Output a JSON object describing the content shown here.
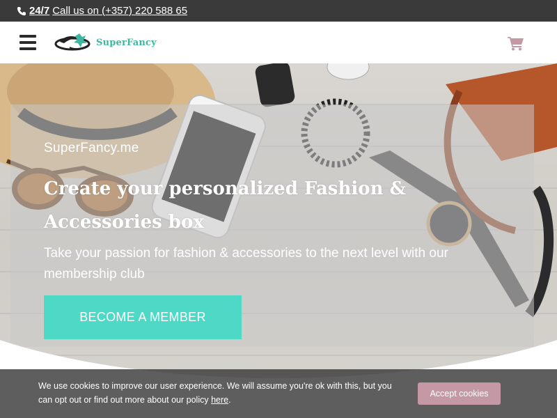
{
  "topbar": {
    "hours": "24/7",
    "call": "Call us on (+357) 220 588 65"
  },
  "header": {
    "brand": "SuperFancy"
  },
  "hero": {
    "site": "SuperFancy.me",
    "headline": "Create your personalized Fashion & Accessories box",
    "subtitle": "Take your passion for fashion & accessories to the next level with our membership club",
    "cta": "BECOME A MEMBER"
  },
  "cookie": {
    "text_before": "We use cookies to improve our user experience. We will assume you're ok with this, but you can opt out or find out more about our policy ",
    "link": "here",
    "text_after": ".",
    "accept": "Accept cookies"
  },
  "colors": {
    "accent": "#4dd9c6",
    "brand": "#3fb7a0",
    "accept_button": "#c598a6",
    "topbar": "#3a3a3a"
  }
}
